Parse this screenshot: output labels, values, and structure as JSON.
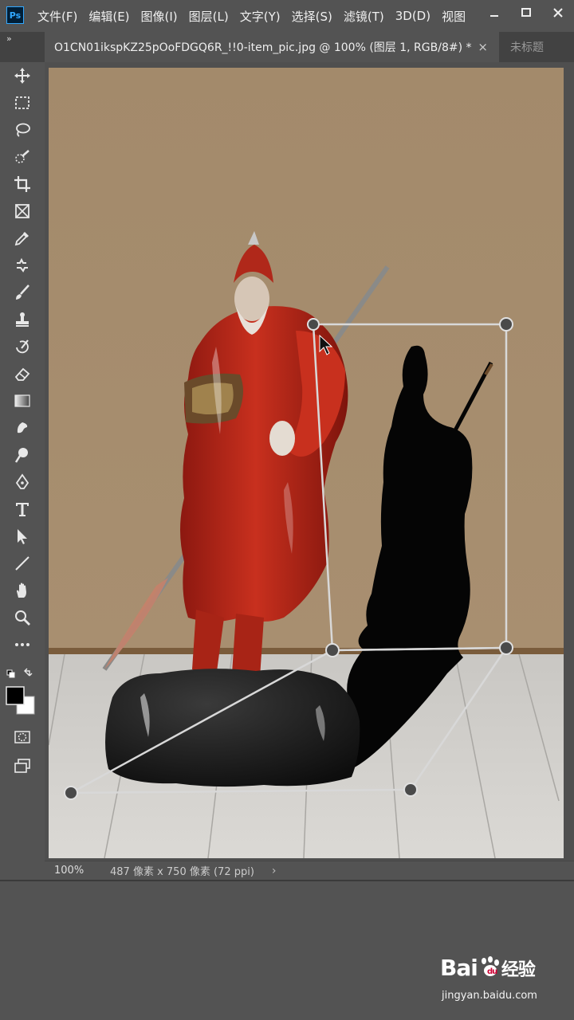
{
  "app": {
    "logo_text": "Ps",
    "menu": [
      "文件(F)",
      "编辑(E)",
      "图像(I)",
      "图层(L)",
      "文字(Y)",
      "选择(S)",
      "滤镜(T)",
      "3D(D)",
      "视图"
    ]
  },
  "tabs": {
    "collapse_label": "»",
    "active_title": "O1CN01ikspKZ25pOoFDGQ6R_!!0-item_pic.jpg @ 100% (图层 1, RGB/8#) *",
    "close_label": "×",
    "inactive_title": "未标题"
  },
  "tools": [
    "move-tool",
    "marquee-tool",
    "lasso-tool",
    "quick-select-tool",
    "crop-tool",
    "frame-tool",
    "eyedropper-tool",
    "healing-tool",
    "brush-tool",
    "stamp-tool",
    "history-brush-tool",
    "eraser-tool",
    "gradient-tool",
    "blur-tool",
    "dodge-tool",
    "pen-tool",
    "type-tool",
    "path-select-tool",
    "line-tool",
    "hand-tool",
    "zoom-tool",
    "more-tools"
  ],
  "colors": {
    "foreground": "#000000",
    "background": "#ffffff",
    "wall": "#a58c6e",
    "floor": "#d2d0cc",
    "statue_red": "#b4281a"
  },
  "status": {
    "zoom": "100%",
    "doc_info": "487 像素 x 750 像素 (72 ppi)",
    "arrow": "›"
  },
  "watermark": {
    "logo": "Bai",
    "logo_cn": "经验",
    "subtitle": "jingyan.baidu.com"
  }
}
